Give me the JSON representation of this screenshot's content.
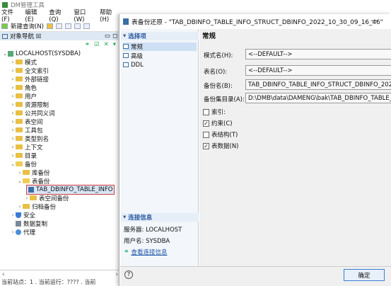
{
  "main": {
    "title": "DM管理工具",
    "menu": [
      "文件(F)",
      "编辑(E)",
      "查询(Q)",
      "窗口(W)",
      "帮助(H)"
    ],
    "toolbar_new_query": "新建查询(N)"
  },
  "nav": {
    "title": "对象导航 ☒",
    "root": "LOCALHOST(SYSDBA)",
    "items": [
      "模式",
      "全文索引",
      "外部链接",
      "角色",
      "用户",
      "资源限制",
      "公共同义词",
      "表空间",
      "工具包",
      "类型别名",
      "上下文",
      "目录",
      "备份",
      "库备份",
      "表备份",
      "TAB_DBINFO_TABLE_INFO",
      "表空间备份",
      "归档备份",
      "安全",
      "数据复制",
      "代理"
    ]
  },
  "status_text": "当前站点：1 . 当前运行：???? . 当前",
  "dialog": {
    "title": "表备份还原 - \"TAB_DBINFO_TABLE_INFO_STRUCT_DBINFO_2022_10_30_09_16_46\"",
    "select_header": "选择项",
    "pages": [
      "常规",
      "高级",
      "DDL"
    ],
    "conn_header": "连接信息",
    "server_label": "服务器: LOCALHOST",
    "user_label": "用户名: SYSDBA",
    "view_conn_link": "查看连接信息",
    "section_title": "常规",
    "fields": [
      {
        "label": "模式名(H):",
        "value": "<--DEFAULT-->"
      },
      {
        "label": "表名(O):",
        "value": "<--DEFAULT-->"
      },
      {
        "label": "备份名(B):",
        "value": "TAB_DBINFO_TABLE_INFO_STRUCT_DBINFO_2022_"
      },
      {
        "label": "备份集目录(A):",
        "value": "D:\\DMB\\data\\DAMENG\\bak\\TAB_DBINFO_TABLE_INFO"
      }
    ],
    "checks": [
      {
        "label": "索引:",
        "checked": false
      },
      {
        "label": "约束(C)",
        "checked": true
      },
      {
        "label": "表结构(T)",
        "checked": false
      },
      {
        "label": "表数据(N)",
        "checked": true
      }
    ],
    "ok": "确定",
    "help": "?"
  }
}
